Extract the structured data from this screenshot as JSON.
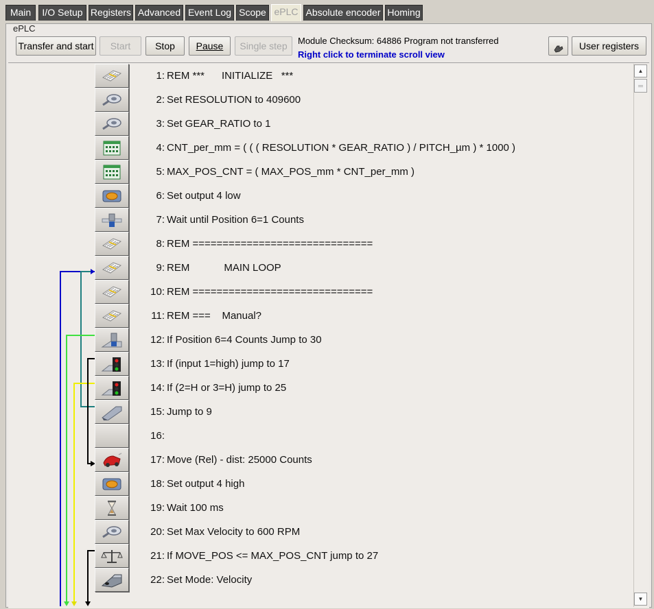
{
  "tabs": [
    {
      "label": "Main"
    },
    {
      "label": "I/O Setup"
    },
    {
      "label": "Registers"
    },
    {
      "label": "Advanced"
    },
    {
      "label": "Event Log"
    },
    {
      "label": "Scope"
    },
    {
      "label": "ePLC"
    },
    {
      "label": "Absolute encoder"
    },
    {
      "label": "Homing"
    }
  ],
  "group_label": "ePLC",
  "toolbar": {
    "transfer_label": "Transfer and start",
    "start_label": "Start",
    "stop_label": "Stop",
    "pause_label": "Pause",
    "single_step_label": "Single step",
    "user_registers_label": "User registers"
  },
  "status": {
    "checksum_text": "Module Checksum: 64886  Program not transferred",
    "scroll_hint": "Right click to terminate scroll view"
  },
  "program": [
    {
      "num": "1:",
      "text": "REM ***      INITIALIZE   ***",
      "icon": "comment-icon"
    },
    {
      "num": "2:",
      "text": "Set RESOLUTION to 409600",
      "icon": "set-register-icon"
    },
    {
      "num": "3:",
      "text": "Set GEAR_RATIO to 1",
      "icon": "set-register-icon"
    },
    {
      "num": "4:",
      "text": "CNT_per_mm = ( ( ( RESOLUTION * GEAR_RATIO ) / PITCH_µm ) * 1000 )",
      "icon": "calculator-icon"
    },
    {
      "num": "5:",
      "text": "MAX_POS_CNT = ( MAX_POS_mm * CNT_per_mm )",
      "icon": "calculator-icon"
    },
    {
      "num": "6:",
      "text": "Set output 4 low",
      "icon": "output-icon"
    },
    {
      "num": "7:",
      "text": "Wait until Position 6=1 Counts",
      "icon": "wait-position-icon"
    },
    {
      "num": "8:",
      "text": "REM ==============================",
      "icon": "comment-icon"
    },
    {
      "num": "9:",
      "text": "REM            MAIN LOOP",
      "icon": "comment-icon"
    },
    {
      "num": "10:",
      "text": "REM ==============================",
      "icon": "comment-icon"
    },
    {
      "num": "11:",
      "text": "REM ===    Manual?",
      "icon": "comment-icon"
    },
    {
      "num": "12:",
      "text": "If Position 6=4 Counts Jump to 30",
      "icon": "if-position-icon"
    },
    {
      "num": "13:",
      "text": "If (input 1=high) jump to 17",
      "icon": "if-input-icon"
    },
    {
      "num": "14:",
      "text": "If (2=H or 3=H) jump to 25",
      "icon": "if-input-icon"
    },
    {
      "num": "15:",
      "text": "Jump to 9",
      "icon": "jump-icon"
    },
    {
      "num": "16:",
      "text": "",
      "icon": "empty-icon"
    },
    {
      "num": "17:",
      "text": "Move (Rel) - dist: 25000 Counts",
      "icon": "move-icon"
    },
    {
      "num": "18:",
      "text": "Set output 4 high",
      "icon": "output-icon"
    },
    {
      "num": "19:",
      "text": "Wait 100 ms",
      "icon": "hourglass-icon"
    },
    {
      "num": "20:",
      "text": "Set Max Velocity to 600 RPM",
      "icon": "set-register-icon"
    },
    {
      "num": "21:",
      "text": "If MOVE_POS <= MAX_POS_CNT jump to 27",
      "icon": "compare-icon"
    },
    {
      "num": "22:",
      "text": "Set Mode: Velocity",
      "icon": "mode-icon"
    }
  ],
  "colors": {
    "wire_blue": "#0000c8",
    "wire_teal": "#208080",
    "wire_green": "#40e040",
    "wire_yellow": "#f0f000",
    "wire_black": "#000000"
  }
}
